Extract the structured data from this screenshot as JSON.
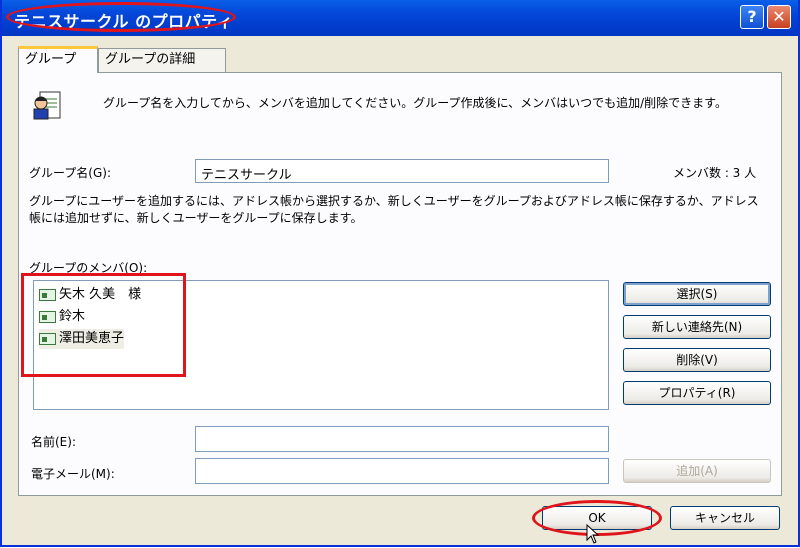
{
  "window": {
    "title": "テニスサークル のプロパティ"
  },
  "titlebar": {
    "help_glyph": "?",
    "close_glyph": "✕"
  },
  "tabs": [
    {
      "label": "グループ",
      "active": true
    },
    {
      "label": "グループの詳細",
      "active": false
    }
  ],
  "intro": {
    "text": "グループ名を入力してから、メンバを追加してください。グループ作成後に、メンバはいつでも追加/削除できます。"
  },
  "group_name": {
    "label": "グループ名(G):",
    "value": "テニスサークル",
    "member_count": "メンバ数 : 3 人"
  },
  "instructions": "グループにユーザーを追加するには、アドレス帳から選択するか、新しくユーザーをグループおよびアドレス帳に保存するか、アドレス帳には追加せずに、新しくユーザーをグループに保存します。",
  "members": {
    "label": "グループのメンバ(O):",
    "items": [
      {
        "name": "矢木 久美　様",
        "selected": false
      },
      {
        "name": "鈴木",
        "selected": false
      },
      {
        "name": "澤田美恵子",
        "selected": true
      }
    ]
  },
  "side_buttons": {
    "select": "選択(S)",
    "new_contact": "新しい連絡先(N)",
    "delete": "削除(V)",
    "properties": "プロパティ(R)"
  },
  "fields": {
    "name_label": "名前(E):",
    "name_value": "",
    "email_label": "電子メール(M):",
    "email_value": "",
    "add_button": "追加(A)"
  },
  "footer": {
    "ok": "OK",
    "cancel": "キャンセル"
  },
  "colors": {
    "annotation": "#e0141b",
    "titlebar": "#0346d8",
    "tab_highlight": "#ffc83c"
  }
}
